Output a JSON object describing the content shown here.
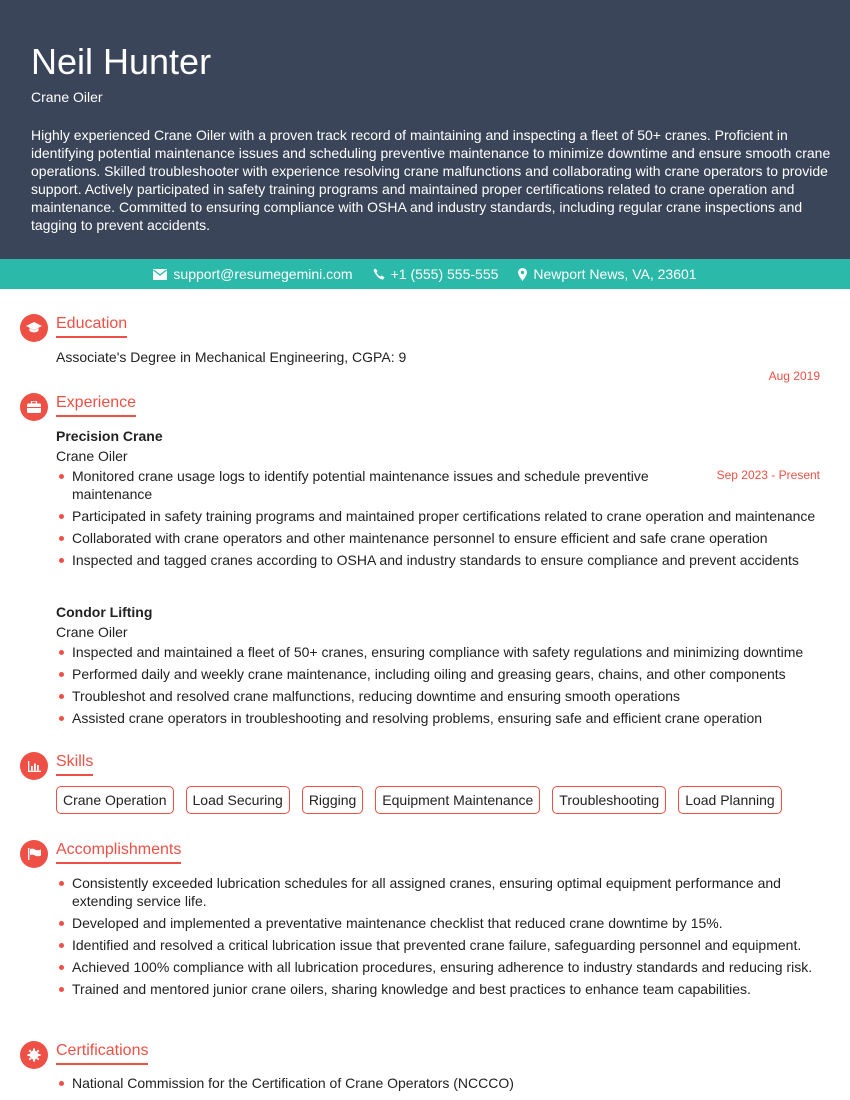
{
  "header": {
    "name": "Neil Hunter",
    "role": "Crane Oiler",
    "summary": "Highly experienced Crane Oiler with a proven track record of maintaining and inspecting a fleet of 50+ cranes. Proficient in identifying potential maintenance issues and scheduling preventive maintenance to minimize downtime and ensure smooth crane operations. Skilled troubleshooter with experience resolving crane malfunctions and collaborating with crane operators to provide support. Actively participated in safety training programs and maintained proper certifications related to crane operation and maintenance. Committed to ensuring compliance with OSHA and industry standards, including regular crane inspections and tagging to prevent accidents."
  },
  "contact": {
    "email": "support@resumegemini.com",
    "phone": "+1 (555) 555-555",
    "location": "Newport News, VA, 23601"
  },
  "education": {
    "title": "Education",
    "degree": "Associate's Degree in Mechanical Engineering, CGPA: 9",
    "date": "Aug 2019"
  },
  "experience": {
    "title": "Experience",
    "jobs": [
      {
        "company": "Precision Crane",
        "role": "Crane Oiler",
        "date": "Sep 2023 - Present",
        "bullets": [
          "Monitored crane usage logs to identify potential maintenance issues and schedule preventive maintenance",
          "Participated in safety training programs and maintained proper certifications related to crane operation and maintenance",
          "Collaborated with crane operators and other maintenance personnel to ensure efficient and safe crane operation",
          "Inspected and tagged cranes according to OSHA and industry standards to ensure compliance and prevent accidents"
        ]
      },
      {
        "company": "Condor Lifting",
        "role": "Crane Oiler",
        "bullets": [
          "Inspected and maintained a fleet of 50+ cranes, ensuring compliance with safety regulations and minimizing downtime",
          "Performed daily and weekly crane maintenance, including oiling and greasing gears, chains, and other components",
          "Troubleshot and resolved crane malfunctions, reducing downtime and ensuring smooth operations",
          "Assisted crane operators in troubleshooting and resolving problems, ensuring safe and efficient crane operation"
        ]
      }
    ]
  },
  "skills": {
    "title": "Skills",
    "items": [
      "Crane Operation",
      "Load Securing",
      "Rigging",
      "Equipment Maintenance",
      "Troubleshooting",
      "Load Planning"
    ]
  },
  "accomplishments": {
    "title": "Accomplishments",
    "items": [
      "Consistently exceeded lubrication schedules for all assigned cranes, ensuring optimal equipment performance and extending service life.",
      "Developed and implemented a preventative maintenance checklist that reduced crane downtime by 15%.",
      "Identified and resolved a critical lubrication issue that prevented crane failure, safeguarding personnel and equipment.",
      "Achieved 100% compliance with all lubrication procedures, ensuring adherence to industry standards and reducing risk.",
      "Trained and mentored junior crane oilers, sharing knowledge and best practices to enhance team capabilities."
    ]
  },
  "certifications": {
    "title": "Certifications",
    "items": [
      "National Commission for the Certification of Crane Operators (NCCCO)"
    ]
  }
}
